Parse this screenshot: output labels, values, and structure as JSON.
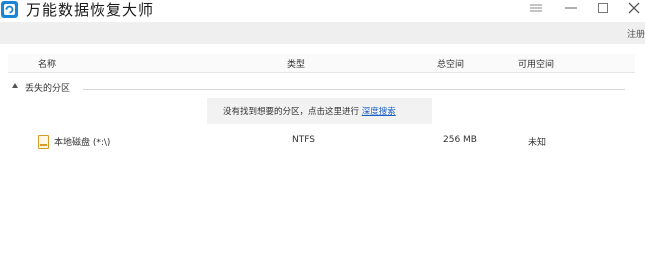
{
  "app": {
    "title": "万能数据恢复大师"
  },
  "toolbar": {
    "register_label": "注册"
  },
  "table": {
    "columns": [
      "名称",
      "类型",
      "总空间",
      "可用空间"
    ],
    "group": {
      "label": "丢失的分区"
    },
    "hint": {
      "text": "没有找到想要的分区，点击这里进行 ",
      "link": "深度搜索"
    },
    "rows": [
      {
        "name": "本地磁盘 (*:\\)",
        "type": "NTFS",
        "total": "256 MB",
        "free": "未知"
      }
    ]
  },
  "icons": {
    "logo": "app-logo-icon",
    "menu": "hamburger-menu-icon",
    "minimize": "minimize-icon",
    "maximize": "maximize-icon",
    "close": "close-icon",
    "disk": "disk-icon",
    "toggle": "collapse-triangle-icon"
  },
  "colors": {
    "accent": "#1b86d6",
    "link": "#1a5fc8",
    "disk_icon": "#d69b2b"
  }
}
